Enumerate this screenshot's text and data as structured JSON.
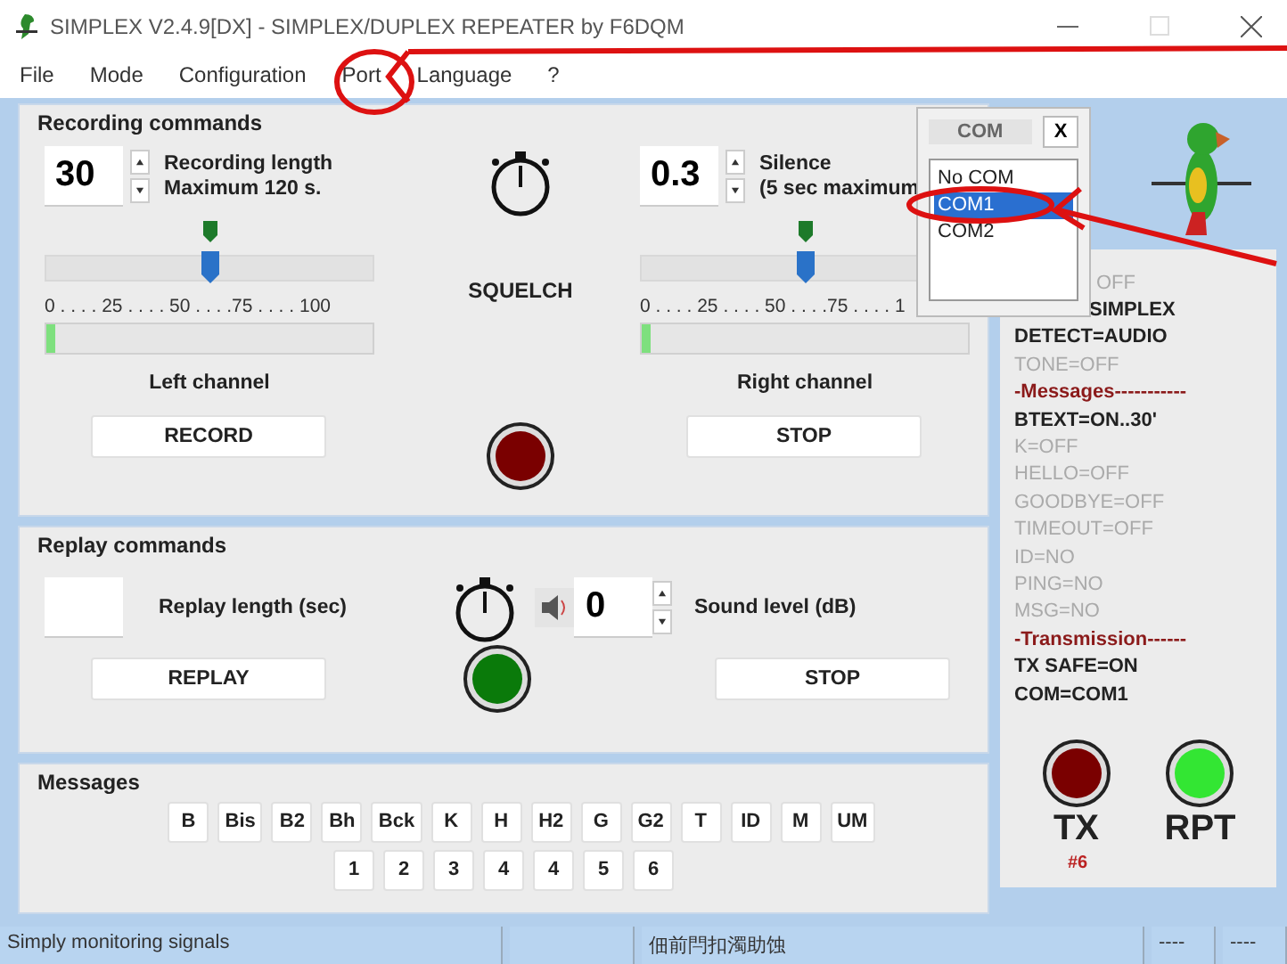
{
  "window": {
    "title": "SIMPLEX V2.4.9[DX] - SIMPLEX/DUPLEX REPEATER by F6DQM"
  },
  "menu": [
    {
      "label": "File"
    },
    {
      "label": "Mode"
    },
    {
      "label": "Configuration"
    },
    {
      "label": "Port"
    },
    {
      "label": "Language"
    },
    {
      "label": "?"
    }
  ],
  "recording": {
    "title": "Recording commands",
    "center_label": "SQUELCH",
    "led": {
      "color": "#7a0000"
    },
    "channels": [
      {
        "value": "30",
        "label_1": "Recording length",
        "label_2": "Maximum 120 s.",
        "slider": {
          "level": 0.5,
          "marker": {
            "level": 0.5
          }
        },
        "scale": "0 . . . . 25 . . . . 50 . . . .75 . . . . 100",
        "meter": {
          "level": 0.03
        },
        "channel": "Left channel",
        "button": "RECORD"
      },
      {
        "value": "0.3",
        "label_1": "Silence",
        "label_2": "(5 sec maximum",
        "slider": {
          "level": 0.5,
          "marker": {
            "level": 0.5
          }
        },
        "scale": "0 . . . . 25 . . . . 50 . . . .75 . . . . 1",
        "meter": {
          "level": 0.03
        },
        "channel": "Right channel",
        "button": "STOP"
      }
    ]
  },
  "replay": {
    "title": "Replay commands",
    "length_label": "Replay length (sec)",
    "sound_value": "0",
    "sound_label": "Sound level (dB)",
    "led": {
      "color": "#0a7a0a"
    },
    "buttons": [
      "REPLAY",
      "STOP"
    ]
  },
  "messages": {
    "title": "Messages",
    "row_1": [
      "B",
      "Bis",
      "B2",
      "Bh",
      "Bck",
      "K",
      "H",
      "H2",
      "G",
      "G2",
      "T",
      "ID",
      "M",
      "UM"
    ],
    "row_2": [
      "1",
      "2",
      "3",
      "4",
      "4",
      "5",
      "6"
    ]
  },
  "com_dialog": {
    "title": "COM",
    "close": "X",
    "items": [
      {
        "label": "No COM",
        "selected": false
      },
      {
        "label": "COM1",
        "selected": true
      },
      {
        "label": "COM2",
        "selected": false
      }
    ]
  },
  "status_lines": [
    {
      "text": "OFF",
      "kind": "inactive",
      "covered": true
    },
    {
      "text": "SIMPLEX",
      "kind": "active",
      "covered": true
    },
    {
      "text": "DETECT=AUDIO",
      "kind": "active",
      "covered": false
    },
    {
      "text": "TONE=OFF",
      "kind": "inactive",
      "covered": false
    },
    {
      "text": "-Messages-----------",
      "kind": "heading",
      "covered": false
    },
    {
      "text": "BTEXT=ON..30'",
      "kind": "active",
      "covered": false
    },
    {
      "text": "K=OFF",
      "kind": "inactive",
      "covered": false
    },
    {
      "text": "HELLO=OFF",
      "kind": "inactive",
      "covered": false
    },
    {
      "text": "GOODBYE=OFF",
      "kind": "inactive",
      "covered": false
    },
    {
      "text": "TIMEOUT=OFF",
      "kind": "inactive",
      "covered": false
    },
    {
      "text": "ID=NO",
      "kind": "inactive",
      "covered": false
    },
    {
      "text": "PING=NO",
      "kind": "inactive",
      "covered": false
    },
    {
      "text": "MSG=NO",
      "kind": "inactive",
      "covered": false
    },
    {
      "text": "-Transmission------",
      "kind": "heading",
      "covered": false
    },
    {
      "text": "TX SAFE=ON",
      "kind": "active",
      "covered": false
    },
    {
      "text": "COM=COM1",
      "kind": "active",
      "covered": false
    }
  ],
  "indicators": [
    {
      "label": "TX",
      "color": "#7a0000"
    },
    {
      "label": "RPT",
      "color": "#33e633"
    }
  ],
  "counter": "#6",
  "status_bar": {
    "cells": [
      {
        "text": "Simply monitoring signals",
        "kind": "wide"
      },
      {
        "text": "",
        "kind": "blank"
      },
      {
        "text": "佃前閂扣濁助蚀",
        "kind": "wide"
      },
      {
        "text": "----",
        "kind": "small"
      },
      {
        "text": "----",
        "kind": "small"
      }
    ]
  },
  "annotations": [
    {
      "kind": "ring-with-arrow"
    },
    {
      "kind": "ring-with-arrow"
    }
  ]
}
